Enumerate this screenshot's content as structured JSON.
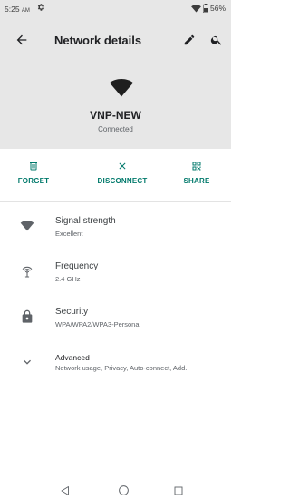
{
  "status_bar": {
    "time": "5:25",
    "ampm": "AM",
    "battery": "56%"
  },
  "app_bar": {
    "title": "Network details"
  },
  "network": {
    "name": "VNP-NEW",
    "status": "Connected"
  },
  "actions": {
    "forget": "FORGET",
    "disconnect": "DISCONNECT",
    "share": "SHARE"
  },
  "details": {
    "signal": {
      "title": "Signal strength",
      "value": "Excellent"
    },
    "frequency": {
      "title": "Frequency",
      "value": "2.4 GHz"
    },
    "security": {
      "title": "Security",
      "value": "WPA/WPA2/WPA3-Personal"
    },
    "advanced": {
      "title": "Advanced",
      "value": "Network usage, Privacy, Auto-connect, Add.."
    }
  },
  "colors": {
    "accent": "#00796b",
    "header_bg": "#e7e7e7",
    "icon": "#5f6368"
  },
  "icons": [
    "gear-icon",
    "wifi-status-icon",
    "battery-icon",
    "back-arrow-icon",
    "edit-pencil-icon",
    "search-icon",
    "wifi-icon",
    "trash-icon",
    "close-icon",
    "qr-code-icon",
    "signal-wifi-icon",
    "antenna-icon",
    "lock-icon",
    "chevron-down-icon",
    "nav-back-icon",
    "nav-home-icon",
    "nav-recents-icon"
  ]
}
